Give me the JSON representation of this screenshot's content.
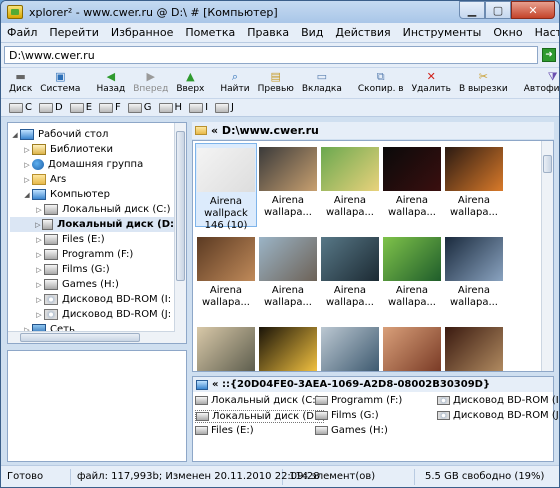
{
  "window": {
    "title": "xplorer² - www.cwer.ru @ D:\\ # [Компьютер]"
  },
  "menu": [
    "Файл",
    "Перейти",
    "Избранное",
    "Пометка",
    "Правка",
    "Вид",
    "Действия",
    "Инструменты",
    "Окно",
    "Настроить",
    "Справка"
  ],
  "address": {
    "value": "D:\\www.cwer.ru"
  },
  "toolbar": [
    {
      "label": "Диск",
      "icon": "drive-icon"
    },
    {
      "label": "Система",
      "icon": "system-icon"
    },
    {
      "label": "Назад",
      "icon": "back-icon"
    },
    {
      "label": "Вперед",
      "icon": "forward-icon",
      "disabled": true
    },
    {
      "label": "Вверх",
      "icon": "up-icon"
    },
    {
      "label": "Найти",
      "icon": "find-icon"
    },
    {
      "label": "Превью",
      "icon": "preview-icon"
    },
    {
      "label": "Вкладка",
      "icon": "tab-icon"
    },
    {
      "label": "Скопир. в",
      "icon": "copy-to-icon"
    },
    {
      "label": "Удалить",
      "icon": "delete-icon"
    },
    {
      "label": "В вырезки",
      "icon": "scrap-icon"
    },
    {
      "label": "Автофильтр",
      "icon": "filter-icon"
    }
  ],
  "drives": [
    "C",
    "D",
    "E",
    "F",
    "G",
    "H",
    "I",
    "J"
  ],
  "tree": [
    {
      "label": "Рабочий стол",
      "icon": "monitor",
      "depth": 0,
      "twist": "◢"
    },
    {
      "label": "Библиотеки",
      "icon": "lib",
      "depth": 1,
      "twist": "▷"
    },
    {
      "label": "Домашняя группа",
      "icon": "people",
      "depth": 1,
      "twist": "▷"
    },
    {
      "label": "Ars",
      "icon": "folder",
      "depth": 1,
      "twist": "▷"
    },
    {
      "label": "Компьютер",
      "icon": "monitor",
      "depth": 1,
      "twist": "◢"
    },
    {
      "label": "Локальный диск (C:)",
      "icon": "drive",
      "depth": 2,
      "twist": "▷"
    },
    {
      "label": "Локальный диск (D:",
      "icon": "drive",
      "depth": 2,
      "twist": "▷",
      "selected": true
    },
    {
      "label": "Files (E:)",
      "icon": "drive",
      "depth": 2,
      "twist": "▷"
    },
    {
      "label": "Programm (F:)",
      "icon": "drive",
      "depth": 2,
      "twist": "▷"
    },
    {
      "label": "Films (G:)",
      "icon": "drive",
      "depth": 2,
      "twist": "▷"
    },
    {
      "label": "Games (H:)",
      "icon": "drive",
      "depth": 2,
      "twist": "▷"
    },
    {
      "label": "Дисковод BD-ROM (I:",
      "icon": "optical",
      "depth": 2,
      "twist": "▷"
    },
    {
      "label": "Дисковод BD-ROM (J:",
      "icon": "optical",
      "depth": 2,
      "twist": "▷"
    },
    {
      "label": "Сеть",
      "icon": "net",
      "depth": 1,
      "twist": "▷"
    }
  ],
  "path": {
    "label": "« D:\\www.cwer.ru"
  },
  "thumbnails": [
    {
      "lines": [
        "Airena",
        "wallpack",
        "146 (10)"
      ],
      "selected": true,
      "colors": [
        "#f4f4f4",
        "#ddd"
      ]
    },
    {
      "lines": [
        "Airena",
        "wallapa..."
      ],
      "colors": [
        "#3a3a3a",
        "#c8a070"
      ]
    },
    {
      "lines": [
        "Airena",
        "wallapa..."
      ],
      "colors": [
        "#6aa84f",
        "#e9d27c"
      ]
    },
    {
      "lines": [
        "Airena",
        "wallapa..."
      ],
      "colors": [
        "#0a0a0a",
        "#3a0f0f"
      ]
    },
    {
      "lines": [
        "Airena",
        "wallapa..."
      ],
      "colors": [
        "#2b1a12",
        "#d97a2a"
      ]
    },
    {
      "lines": [
        "Airena",
        "wallapa..."
      ],
      "colors": [
        "#5b3a22",
        "#c08a5a"
      ]
    },
    {
      "lines": [
        "Airena",
        "wallapa..."
      ],
      "colors": [
        "#9bb4c6",
        "#6d6257"
      ]
    },
    {
      "lines": [
        "Airena",
        "wallapa..."
      ],
      "colors": [
        "#587887",
        "#1c2a33"
      ]
    },
    {
      "lines": [
        "Airena",
        "wallapa..."
      ],
      "colors": [
        "#7fc34a",
        "#1f5d2b"
      ]
    },
    {
      "lines": [
        "Airena",
        "wallapa..."
      ],
      "colors": [
        "#1a2a3d",
        "#8aa3c0"
      ]
    },
    {
      "lines": [
        "Airena",
        "wallapa..."
      ],
      "colors": [
        "#d8c8a8",
        "#5e5e4e"
      ]
    },
    {
      "lines": [
        "Airena",
        "wallapa..."
      ],
      "colors": [
        "#1a1408",
        "#f0c040"
      ]
    },
    {
      "lines": [
        "Airena",
        "wallapa..."
      ],
      "colors": [
        "#bcc8d2",
        "#3e5a70"
      ]
    },
    {
      "lines": [
        "Airena",
        "wallapa..."
      ],
      "colors": [
        "#d9a07a",
        "#7a3b26"
      ]
    },
    {
      "lines": [
        "Airena",
        "wallapa..."
      ],
      "colors": [
        "#3a1a10",
        "#b08a60"
      ]
    }
  ],
  "bottom_pane": {
    "path": "« ::{20D04FE0-3AEA-1069-A2D8-08002B30309D}",
    "items": [
      {
        "label": "Локальный диск (C:)",
        "col": 0,
        "row": 0,
        "icon": "drive"
      },
      {
        "label": "Локальный диск (D:)",
        "col": 0,
        "row": 1,
        "icon": "drive",
        "boxed": true
      },
      {
        "label": "Files (E:)",
        "col": 0,
        "row": 2,
        "icon": "drive"
      },
      {
        "label": "Programm (F:)",
        "col": 1,
        "row": 0,
        "icon": "drive"
      },
      {
        "label": "Films (G:)",
        "col": 1,
        "row": 1,
        "icon": "drive"
      },
      {
        "label": "Games (H:)",
        "col": 1,
        "row": 2,
        "icon": "drive"
      },
      {
        "label": "Дисковод BD-ROM (I:)",
        "col": 2,
        "row": 0,
        "icon": "optical"
      },
      {
        "label": "Дисковод BD-ROM (J:)",
        "col": 2,
        "row": 1,
        "icon": "optical"
      }
    ]
  },
  "status": {
    "ready": "Готово",
    "fileinfo": "файл: 117,993b; Изменен 20.11.2010 22:09:28",
    "count": "114 элемент(ов)",
    "free": "5.5 GB свободно (19%)"
  }
}
